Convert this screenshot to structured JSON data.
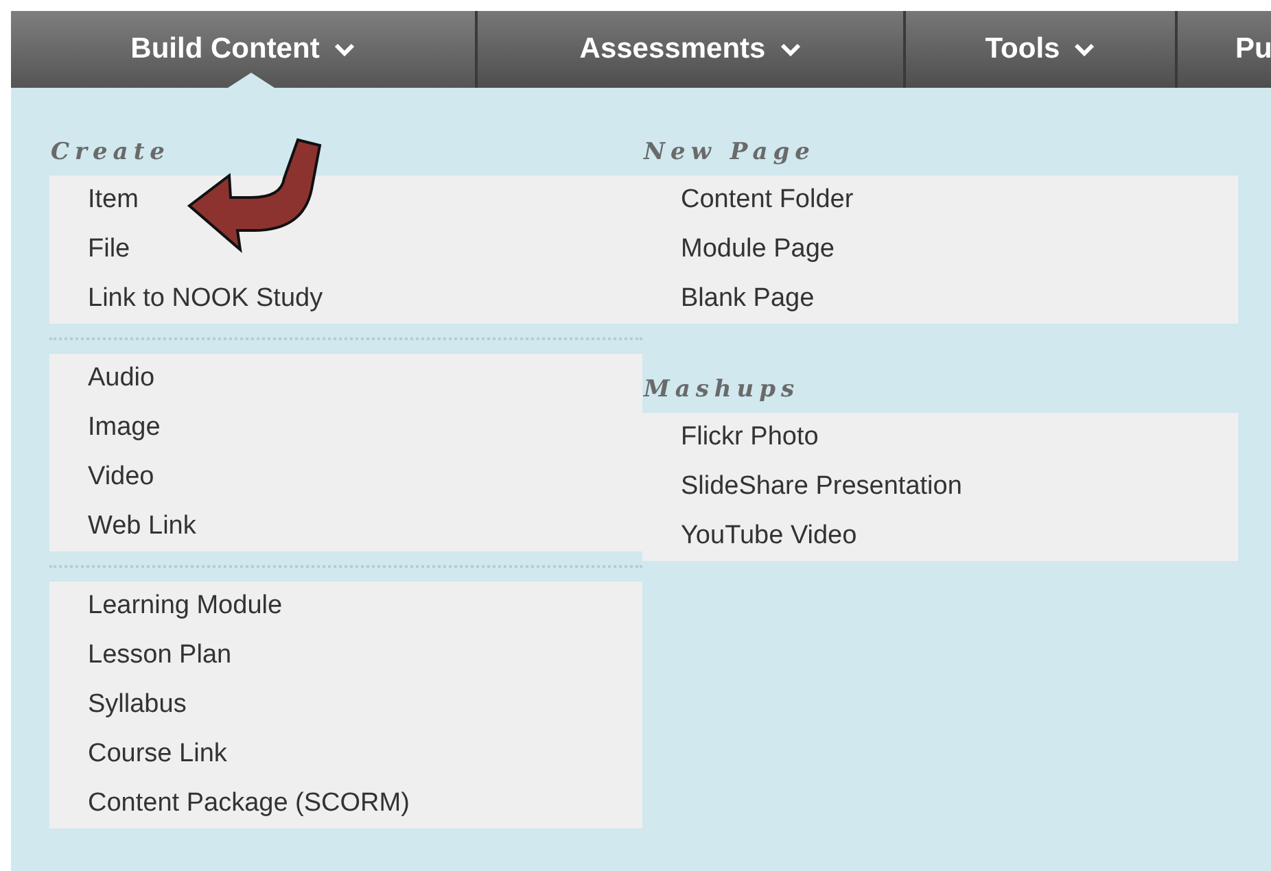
{
  "tabs": [
    {
      "label": "Build Content",
      "selected": true,
      "chevron": true
    },
    {
      "label": "Assessments",
      "selected": false,
      "chevron": true
    },
    {
      "label": "Tools",
      "selected": false,
      "chevron": true
    },
    {
      "label": "Pu",
      "selected": false,
      "chevron": false
    }
  ],
  "menu": {
    "left": {
      "heading": "Create",
      "groups": [
        [
          "Item",
          "File",
          "Link to NOOK Study"
        ],
        [
          "Audio",
          "Image",
          "Video",
          "Web Link"
        ],
        [
          "Learning Module",
          "Lesson Plan",
          "Syllabus",
          "Course Link",
          "Content Package (SCORM)"
        ]
      ]
    },
    "right": [
      {
        "heading": "New Page",
        "items": [
          "Content Folder",
          "Module Page",
          "Blank Page"
        ]
      },
      {
        "heading": "Mashups",
        "items": [
          "Flickr Photo",
          "SlideShare Presentation",
          "YouTube Video"
        ]
      }
    ]
  }
}
